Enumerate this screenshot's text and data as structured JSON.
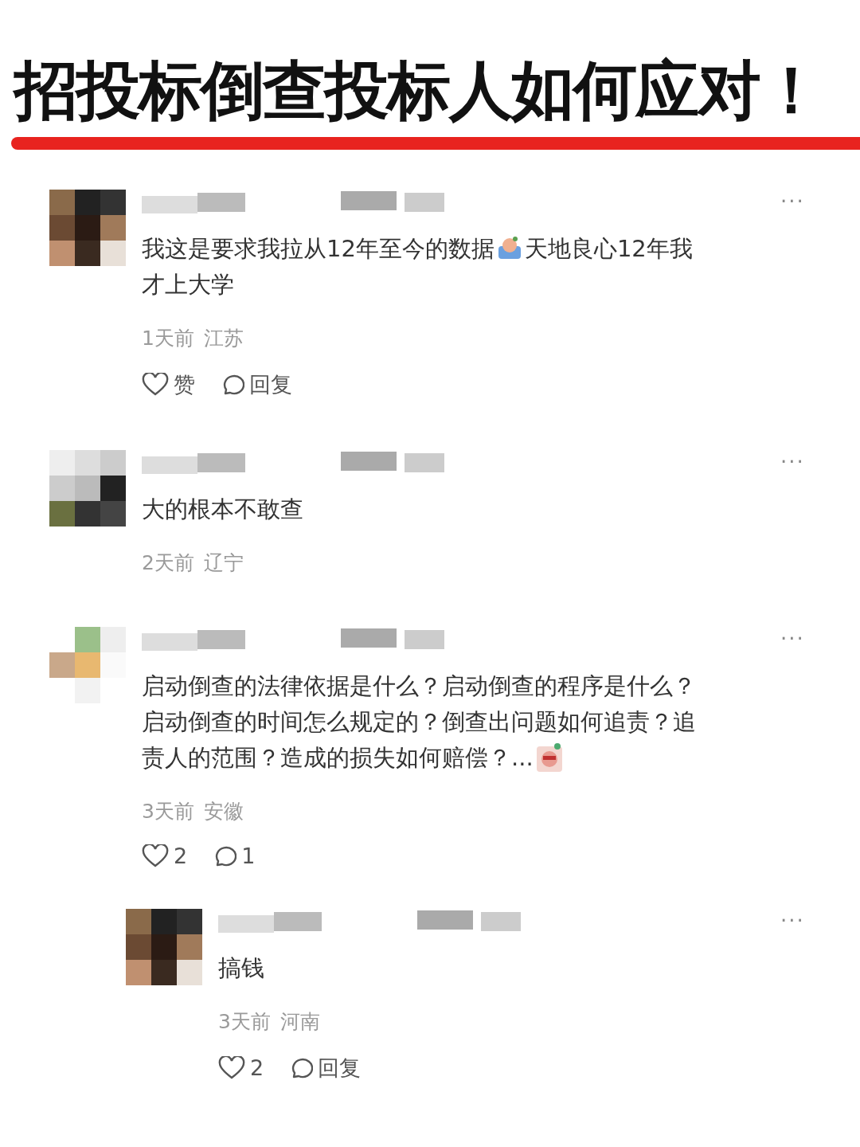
{
  "title": "招投标倒查投标人如何应对！",
  "comments": [
    {
      "more": "···",
      "lines": [
        [
          {
            "kind": "text",
            "text": "我这是要求我拉从12年至今的数据"
          },
          {
            "kind": "emoji"
          },
          {
            "kind": "text",
            "text": "天地良心12年我"
          }
        ],
        [
          {
            "kind": "text",
            "text": "才上大学"
          }
        ]
      ],
      "time": "1天前",
      "region": "江苏",
      "like_label": "赞",
      "reply_label": "回复"
    },
    {
      "more": "···",
      "lines": [
        [
          {
            "kind": "text",
            "text": "大的根本不敢查"
          }
        ]
      ],
      "time": "2天前",
      "region": "辽宁"
    },
    {
      "more": "···",
      "lines": [
        [
          {
            "kind": "text",
            "text": "启动倒查的法律依据是什么？启动倒查的程序是什么？"
          }
        ],
        [
          {
            "kind": "text",
            "text": "启动倒查的时间怎么规定的？倒查出问题如何追责？追"
          }
        ],
        [
          {
            "kind": "text",
            "text": "责人的范围？造成的损失如何赔偿？..."
          },
          {
            "kind": "sticker"
          }
        ]
      ],
      "time": "3天前",
      "region": "安徽",
      "like_label": "2",
      "reply_label": "1",
      "children": [
        {
          "more": "···",
          "lines": [
            [
              {
                "kind": "text",
                "text": "搞钱"
              }
            ]
          ],
          "time": "3天前",
          "region": "河南",
          "like_label": "2",
          "reply_label": "回复"
        }
      ]
    }
  ]
}
